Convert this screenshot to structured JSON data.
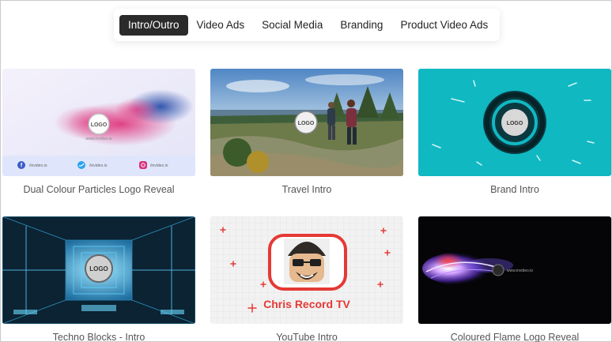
{
  "tabs": [
    {
      "label": "Intro/Outro",
      "active": true
    },
    {
      "label": "Video Ads",
      "active": false
    },
    {
      "label": "Social Media",
      "active": false
    },
    {
      "label": "Branding",
      "active": false
    },
    {
      "label": "Product Video Ads",
      "active": false
    }
  ],
  "cards": [
    {
      "title": "Dual Colour Particles Logo Reveal",
      "logo_text": "LOGO",
      "url_text": "www.invideo.io",
      "social": [
        {
          "icon": "facebook-icon",
          "handle": "/invideo.io"
        },
        {
          "icon": "twitter-icon",
          "handle": "/invideo.io"
        },
        {
          "icon": "instagram-icon",
          "handle": "/invideo.io"
        }
      ]
    },
    {
      "title": "Travel Intro",
      "logo_text": "LOGO"
    },
    {
      "title": "Brand Intro",
      "logo_text": "LOGO",
      "accent": "#10b8c2"
    },
    {
      "title": "Techno Blocks - Intro",
      "logo_text": "LOGO"
    },
    {
      "title": "YouTube Intro",
      "channel_name": "Chris Record TV",
      "accent": "#e53935"
    },
    {
      "title": "Coloured Flame Logo Reveal",
      "url_text": "www.invideo.io"
    }
  ],
  "colors": {
    "tab_active_bg": "#2b2b2b",
    "brand_teal": "#10b8c2",
    "youtube_red": "#e53935"
  }
}
